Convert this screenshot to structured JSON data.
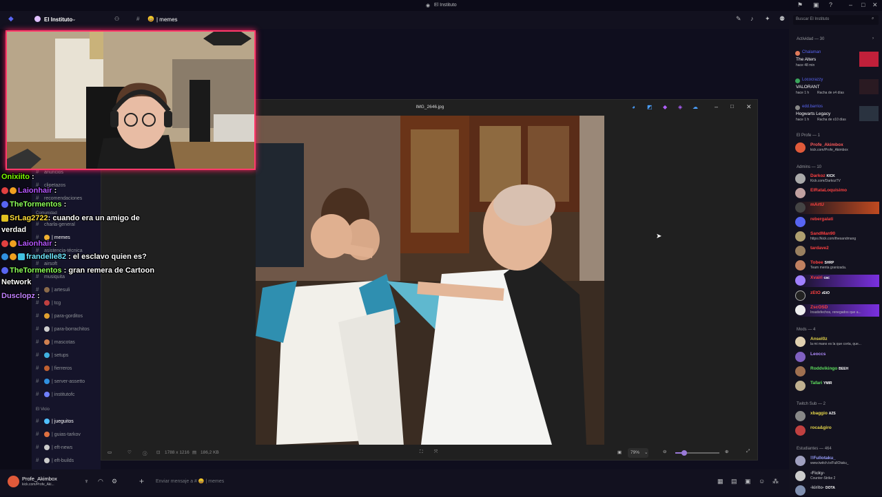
{
  "window": {
    "title": "El Instituto"
  },
  "server": {
    "name": "El Instituto",
    "current_channel": "| memes",
    "search_placeholder": "Buscar El Instituto"
  },
  "channels": {
    "items": [
      {
        "label": "anuncios"
      },
      {
        "label": "clipetazos"
      },
      {
        "label": "recomendaciones"
      },
      {
        "label": "charla-general"
      },
      {
        "label": "| memes"
      },
      {
        "label": "asistencia-técnica"
      },
      {
        "label": "airsoft"
      },
      {
        "label": "musiquita"
      },
      {
        "label": "| artesuli"
      },
      {
        "label": "| tcg"
      },
      {
        "label": "| para-gorditos"
      },
      {
        "label": "| para-borrachitos"
      },
      {
        "label": "| mascotas"
      },
      {
        "label": "| setups"
      },
      {
        "label": "| fierreros"
      },
      {
        "label": "| server-assetto"
      },
      {
        "label": "| institutofc"
      }
    ],
    "categories": {
      "comunidad": "Comunidad",
      "vicio": "El Vicio"
    },
    "vicio_items": [
      {
        "label": "| jueguitos"
      },
      {
        "label": "| guias-tarkov"
      },
      {
        "label": "| eft-news"
      },
      {
        "label": "| eft-builds"
      }
    ]
  },
  "chat_overlay": [
    {
      "user": "Onixiito",
      "text": ":",
      "color": "#7CFC00"
    },
    {
      "user": "Laionhair",
      "text": ":",
      "color": "#b455ff"
    },
    {
      "user": "TheTormentos",
      "text": ":",
      "color": "#8cff5a"
    },
    {
      "user": "SrLag2722",
      "text": ": cuando era un amigo de",
      "color": "#ffde3a"
    },
    {
      "user": "",
      "text": "verdad",
      "color": "#ffffff"
    },
    {
      "user": "Laionhair",
      "text": ":",
      "color": "#b455ff"
    },
    {
      "user": "frandelle82",
      "text": ": el esclavo quien es?",
      "color": "#6ee6ff"
    },
    {
      "user": "TheTormentos",
      "text": ": gran remera de Cartoon",
      "color": "#8cff5a"
    },
    {
      "user": "",
      "text": "Network",
      "color": "#ffffff"
    },
    {
      "user": "Dusclopz",
      "text": ":",
      "color": "#c080ff"
    }
  ],
  "viewer": {
    "filename": "IMG_2646.jpg",
    "dimensions": "1788 x 1216",
    "filesize": "186,2 KB",
    "zoom": "79%",
    "zoom_level": 0.2
  },
  "user": {
    "name": "Profe_Akimbox",
    "status": "kick.com/Profe_Aki..."
  },
  "composer": {
    "placeholder": "Enviar mensaje a # 😄 | memes"
  },
  "members": {
    "activity_header": "Actividad — 30",
    "activity": [
      {
        "name": "Chalaman",
        "game": "The Alters",
        "time": "hace 48 min",
        "color": "#5865f2"
      },
      {
        "name": "Lococrazzy",
        "game": "VALORANT",
        "time": "hace 1 h",
        "streak": "Racha de x4 días",
        "color": "#5865f2"
      },
      {
        "name": "edd.barrios",
        "game": "Hogwarts Legacy",
        "time": "hace 1 h",
        "streak": "Racha de x10 días",
        "color": "#5865f2"
      }
    ],
    "profe_header": "El Profe — 1",
    "profe": [
      {
        "name": "Profe_Akimbox",
        "status": "kick.com/Profe_Akimbox",
        "color": "#ff5a5a"
      }
    ],
    "admins_header": "Admins — 10",
    "admins": [
      {
        "name": "Darkoz",
        "tag": "KICK",
        "status": "Kick.com/DarkozTV",
        "color": "#ff4040"
      },
      {
        "name": "ElRataLoquisimo",
        "status": "",
        "color": "#ff4040"
      },
      {
        "name": "mArtU",
        "status": "",
        "color": "#ff4040"
      },
      {
        "name": "rebergalati",
        "status": "",
        "color": "#ff4040"
      },
      {
        "name": "SandMan90",
        "status": "https://kick.com/thesandmang",
        "color": "#ff4040"
      },
      {
        "name": "tardave2",
        "status": "",
        "color": "#ff4040"
      },
      {
        "name": "Tobee",
        "tag": "SHRP",
        "status": "Team menta granizada.",
        "color": "#ff4040"
      },
      {
        "name": "Xvairi",
        "tag": "cac",
        "status": "",
        "color": "#ff4040"
      },
      {
        "name": "zEtO",
        "tag": "zEtO",
        "status": "",
        "color": "#ff4040"
      },
      {
        "name": "ZscOSD",
        "status": "Insatisfechos, renegados que a...",
        "color": "#ff4040"
      }
    ],
    "mods_header": "Mods — 4",
    "mods": [
      {
        "name": "Ansel0z",
        "status": "la mi mano es la que corta, que...",
        "color": "#e8d84a"
      },
      {
        "name": "Leoccs",
        "status": "",
        "color": "#b18cff"
      },
      {
        "name": "Roddvikingo",
        "tag": "BEEH",
        "status": "",
        "color": "#5ee05e"
      },
      {
        "name": "Tafari",
        "tag": "YMIR",
        "status": "",
        "color": "#5ee05e"
      }
    ],
    "sub_header": "Twitch Sub — 2",
    "subs": [
      {
        "name": "xbaggio",
        "tag": "AZS",
        "color": "#e8d84a"
      },
      {
        "name": "roca&giro",
        "color": "#e8d84a"
      }
    ],
    "students_header": "Estudiantes — 464",
    "students": [
      {
        "name": "!!Fullotaku_",
        "status": "www.twitch.tv/FullOtaku_",
        "color": "#9aa0ff"
      },
      {
        "name": "-Ficky-",
        "status": "Counter-Strike 2",
        "color": "#b9bbbe"
      },
      {
        "name": "-kirito-",
        "tag": "DOTA",
        "status": "",
        "color": "#b9bbbe"
      }
    ]
  },
  "colors": {
    "accent": "#ff3a6a",
    "bg": "#0e0d1c",
    "panel": "#13121f"
  }
}
